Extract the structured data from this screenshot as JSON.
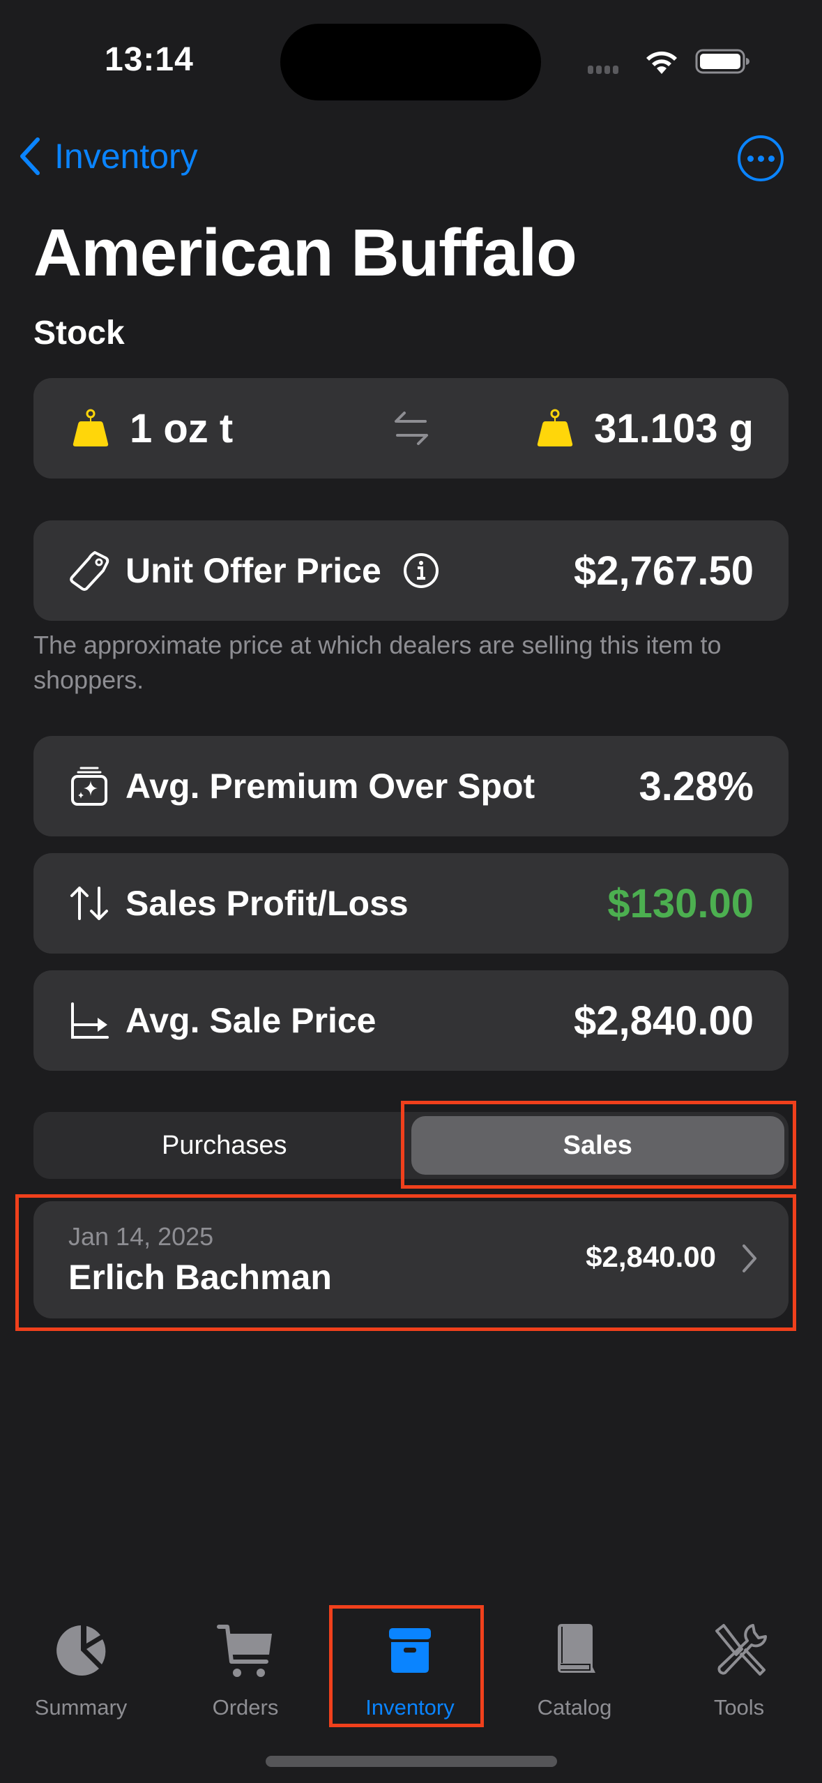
{
  "status_bar": {
    "time": "13:14"
  },
  "nav": {
    "back_label": "Inventory",
    "more_icon": "ellipsis-circle-icon"
  },
  "header": {
    "title": "American Buffalo",
    "section": "Stock"
  },
  "weight": {
    "left_value": "1 oz t",
    "right_value": "31.103 g",
    "icon": "scalemass-icon",
    "icon_color": "#ffd60a"
  },
  "offer": {
    "label": "Unit Offer Price",
    "value": "$2,767.50",
    "footnote": "The approximate price at which dealers are selling this item to shoppers."
  },
  "stats": [
    {
      "label": "Avg. Premium Over Spot",
      "value": "3.28%",
      "icon": "premium-sparkle-icon"
    },
    {
      "label": "Sales Profit/Loss",
      "value": "$130.00",
      "icon": "arrow-up-down-icon",
      "value_color": "#4caf50"
    },
    {
      "label": "Avg. Sale Price",
      "value": "$2,840.00",
      "icon": "chart-axis-arrow-icon"
    }
  ],
  "segment": {
    "options": [
      "Purchases",
      "Sales"
    ],
    "selected": "Sales"
  },
  "sales": [
    {
      "date": "Jan 14, 2025",
      "name": "Erlich Bachman",
      "amount": "$2,840.00"
    }
  ],
  "tabbar": {
    "items": [
      {
        "label": "Summary",
        "icon": "pie-chart-icon"
      },
      {
        "label": "Orders",
        "icon": "cart-icon"
      },
      {
        "label": "Inventory",
        "icon": "archive-box-icon",
        "active": true
      },
      {
        "label": "Catalog",
        "icon": "book-icon"
      },
      {
        "label": "Tools",
        "icon": "wrench-screwdriver-icon"
      }
    ],
    "active_color": "#0a84ff"
  }
}
